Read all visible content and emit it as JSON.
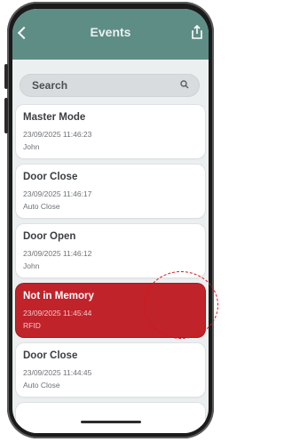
{
  "header": {
    "title": "Events"
  },
  "search": {
    "label": "Search"
  },
  "events": [
    {
      "title": "Master Mode",
      "time": "23/09/2025 11:46:23",
      "source": "John"
    },
    {
      "title": "Door Close",
      "time": "23/09/2025 11:46:17",
      "source": "Auto Close"
    },
    {
      "title": "Door Open",
      "time": "23/09/2025 11:46:12",
      "source": "John"
    },
    {
      "title": "Not in Memory",
      "time": "23/09/2025 11:45:44",
      "source": "RFID"
    },
    {
      "title": "Door Close",
      "time": "23/09/2025 11:44:45",
      "source": "Auto Close"
    }
  ],
  "colors": {
    "header": "#5e8d86",
    "alert": "#c0232a",
    "annotation": "#d8141c",
    "background": "#eceff0"
  },
  "icons": {
    "back": "chevron-left-icon",
    "share": "share-icon",
    "search": "search-icon"
  }
}
